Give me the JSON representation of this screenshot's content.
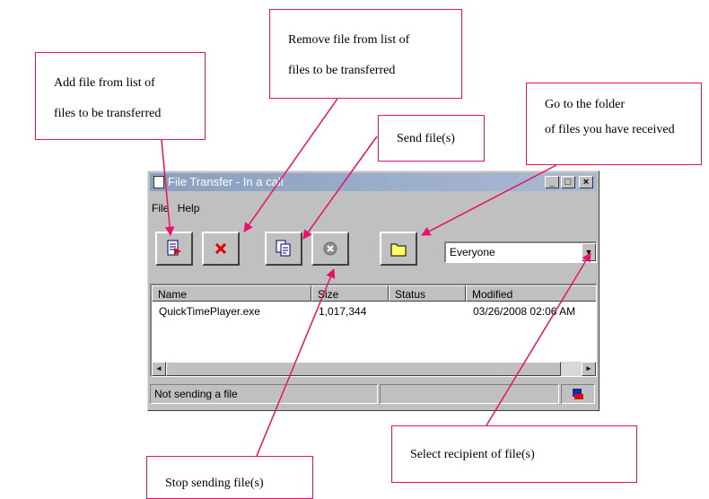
{
  "window": {
    "title": "File Transfer - In a call",
    "menu": [
      "File",
      "Help"
    ],
    "toolbar": {
      "add_icon": "add-file-icon",
      "remove_icon": "remove-file-icon",
      "send_icon": "send-file-icon",
      "stop_icon": "stop-sending-icon",
      "folder_icon": "folder-icon"
    },
    "recipient": {
      "value": "Everyone"
    },
    "columns": [
      "Name",
      "Size",
      "Status",
      "Modified"
    ],
    "rows": [
      {
        "name": "QuickTimePlayer.exe",
        "size": "1,017,344",
        "status": "",
        "modified": "03/26/2008 02:06 AM"
      }
    ],
    "status_text": "Not sending a file"
  },
  "callouts": {
    "add": [
      "Add file from list of",
      "files to be transferred"
    ],
    "remove": [
      "Remove file from list of",
      "files to be transferred"
    ],
    "send": [
      "Send file(s)"
    ],
    "folder": [
      "Go to the folder",
      "of files you have received"
    ],
    "recipient": [
      "Select recipient of  file(s)"
    ],
    "stop": [
      "Stop sending file(s)"
    ]
  },
  "colors": {
    "callout_border": "#e8106a",
    "title_bar": "#8aa0bf",
    "window_face": "#c0c0c0"
  }
}
